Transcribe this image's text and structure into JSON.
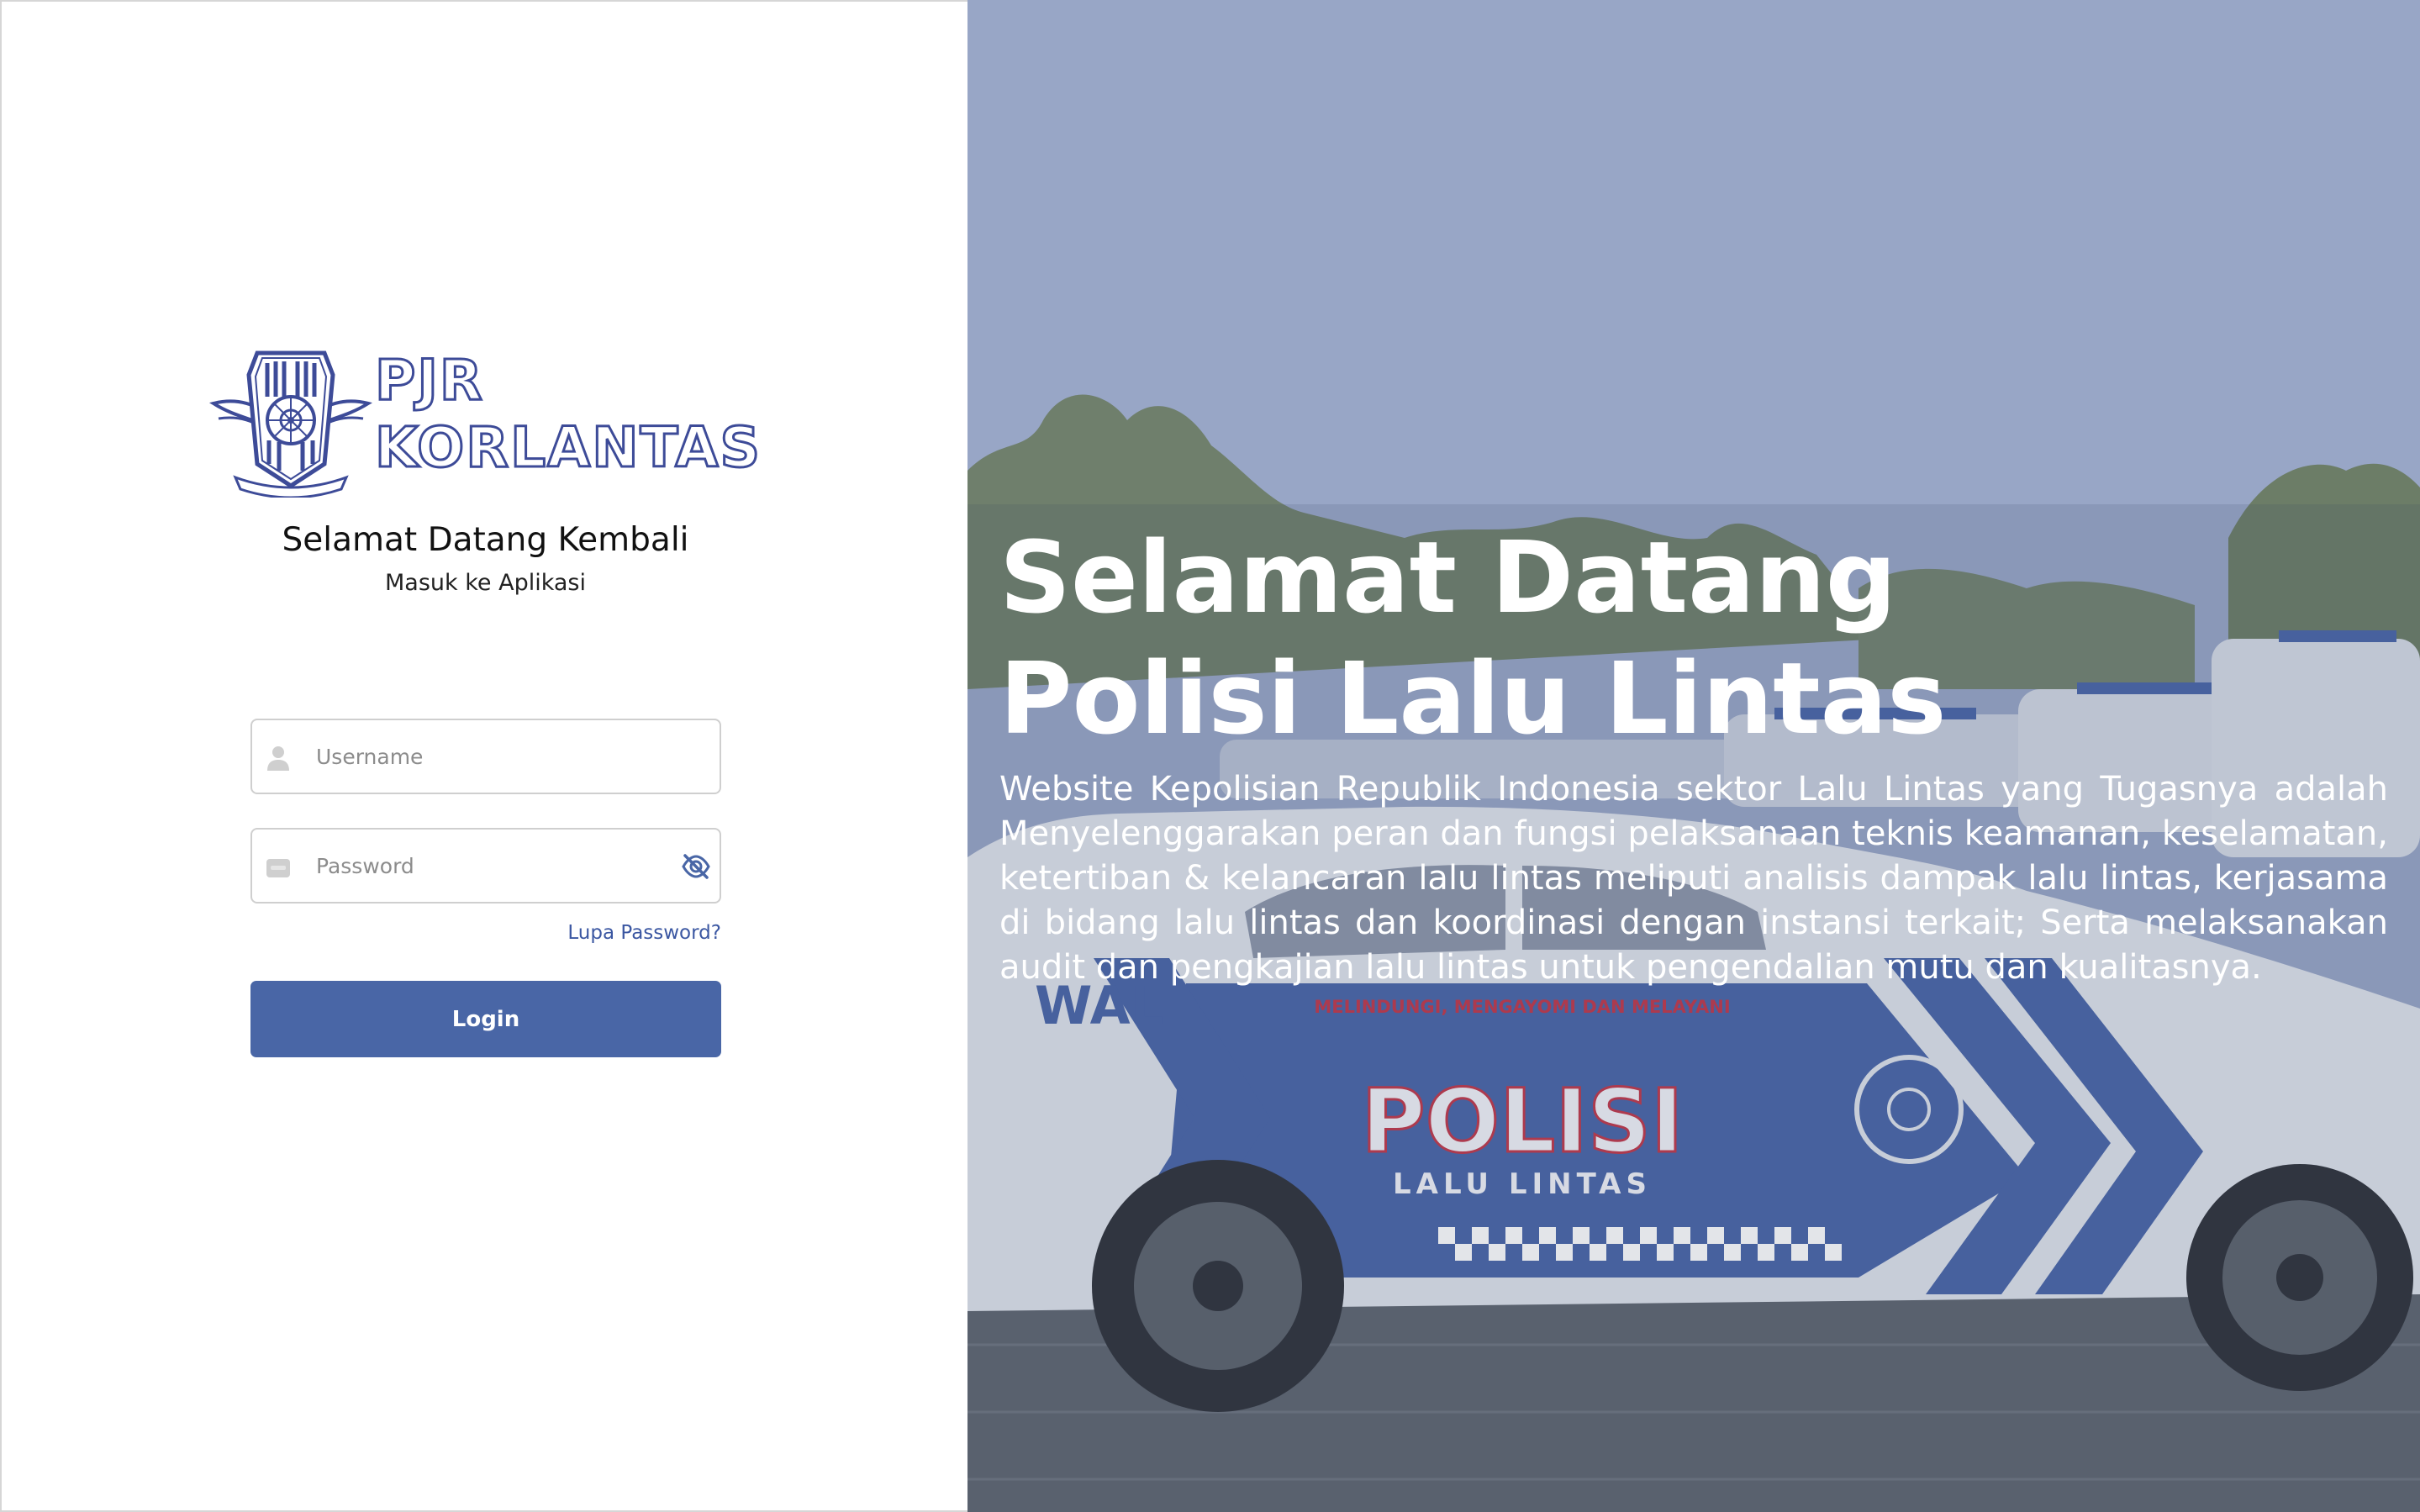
{
  "login": {
    "logo_line1": "PJR",
    "logo_line2": "KORLANTAS",
    "welcome_title": "Selamat Datang Kembali",
    "welcome_subtitle": "Masuk ke Aplikasi",
    "username_placeholder": "Username",
    "password_placeholder": "Password",
    "forgot_label": "Lupa Password?",
    "login_label": "Login"
  },
  "hero": {
    "title_line1": "Selamat Datang",
    "title_line2": "Polisi Lalu Lintas",
    "description": "Website Kepolisian Republik Indonesia sektor Lalu Lintas yang Tugasnya adalah Menyelenggarakan peran dan fungsi pelaksanaan teknis keamanan, keselamatan, ketertiban & kelancaran lalu lintas meliputi analisis dampak lalu lintas, kerjasama di bidang lalu lintas dan koordinasi dengan instansi terkait; Serta melaksanakan audit dan pengkajian lalu lintas untuk pengendalian mutu dan kualitasnya.",
    "car_door_text": "POLISI",
    "car_door_subtext": "LALU LINTAS",
    "car_slogan": "MELINDUNGI, MENGAYOMI DAN MELAYANI",
    "car_front_text": "WAL"
  },
  "colors": {
    "brand_blue": "#4966a6",
    "logo_blue": "#3d4b98",
    "link_blue": "#3b57a2",
    "sky_overlay": "#99a7c6"
  },
  "icons": {
    "username_icon": "user-icon",
    "password_icon": "key-icon",
    "toggle_visibility_icon": "eye-off-icon"
  }
}
